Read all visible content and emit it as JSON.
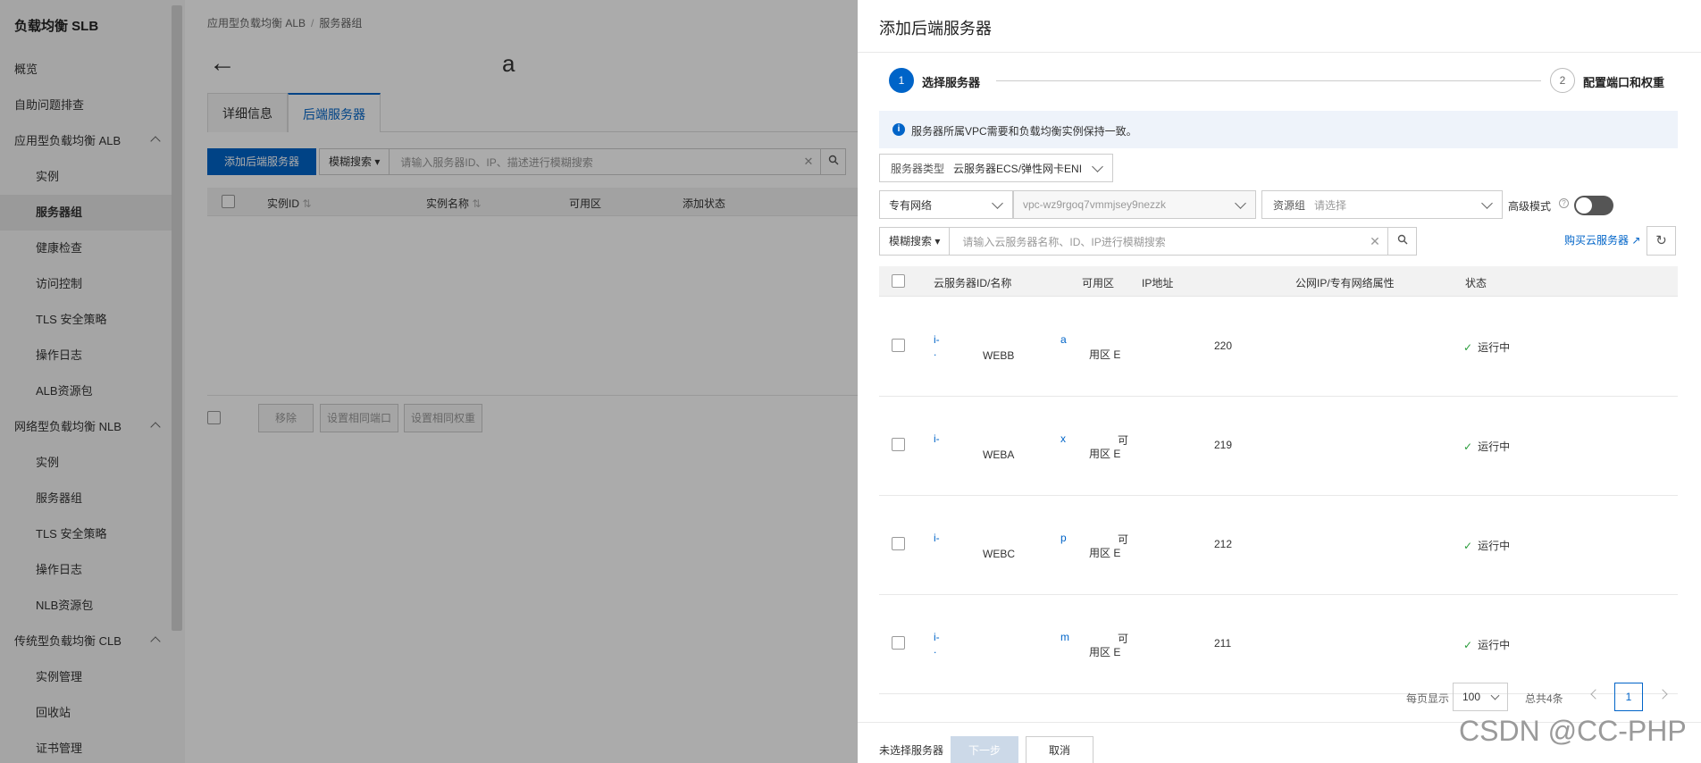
{
  "sidebar": {
    "brand": "负载均衡 SLB",
    "items": [
      {
        "label": "概览",
        "sub": false,
        "active": false,
        "chev": false
      },
      {
        "label": "自助问题排查",
        "sub": false,
        "active": false,
        "chev": false
      },
      {
        "label": "应用型负载均衡 ALB",
        "sub": false,
        "active": false,
        "chev": true
      },
      {
        "label": "实例",
        "sub": true,
        "active": false,
        "chev": false
      },
      {
        "label": "服务器组",
        "sub": true,
        "active": true,
        "chev": false
      },
      {
        "label": "健康检查",
        "sub": true,
        "active": false,
        "chev": false
      },
      {
        "label": "访问控制",
        "sub": true,
        "active": false,
        "chev": false
      },
      {
        "label": "TLS 安全策略",
        "sub": true,
        "active": false,
        "chev": false
      },
      {
        "label": "操作日志",
        "sub": true,
        "active": false,
        "chev": false
      },
      {
        "label": "ALB资源包",
        "sub": true,
        "active": false,
        "chev": false
      },
      {
        "label": "网络型负载均衡 NLB",
        "sub": false,
        "active": false,
        "chev": true
      },
      {
        "label": "实例",
        "sub": true,
        "active": false,
        "chev": false
      },
      {
        "label": "服务器组",
        "sub": true,
        "active": false,
        "chev": false
      },
      {
        "label": "TLS 安全策略",
        "sub": true,
        "active": false,
        "chev": false
      },
      {
        "label": "操作日志",
        "sub": true,
        "active": false,
        "chev": false
      },
      {
        "label": "NLB资源包",
        "sub": true,
        "active": false,
        "chev": false
      },
      {
        "label": "传统型负载均衡 CLB",
        "sub": false,
        "active": false,
        "chev": true
      },
      {
        "label": "实例管理",
        "sub": true,
        "active": false,
        "chev": false
      },
      {
        "label": "回收站",
        "sub": true,
        "active": false,
        "chev": false
      },
      {
        "label": "证书管理",
        "sub": true,
        "active": false,
        "chev": false
      }
    ]
  },
  "main": {
    "breadcrumb": [
      "应用型负载均衡 ALB",
      "服务器组"
    ],
    "back_icon": "←",
    "title_suffix": "a",
    "tabs": [
      "详细信息",
      "后端服务器"
    ],
    "add_button": "添加后端服务器",
    "search_mode": "模糊搜索",
    "search_placeholder": "请输入服务器ID、IP、描述进行模糊搜索",
    "table_headers": [
      "实例ID",
      "实例名称",
      "可用区",
      "添加状态"
    ],
    "footer_buttons": [
      "移除",
      "设置相同端口",
      "设置相同权重"
    ]
  },
  "drawer": {
    "title": "添加后端服务器",
    "steps": [
      {
        "num": "1",
        "label": "选择服务器"
      },
      {
        "num": "2",
        "label": "配置端口和权重"
      }
    ],
    "info": "服务器所属VPC需要和负载均衡实例保持一致。",
    "server_type_label": "服务器类型",
    "server_type_value": "云服务器ECS/弹性网卡ENI",
    "network": "专有网络",
    "vpc": "vpc-wz9rgoq7vmmjsey9nezzk",
    "resource_group_label": "资源组",
    "resource_group_placeholder": "请选择",
    "advanced_mode": "高级模式",
    "search_mode": "模糊搜索",
    "search_placeholder": "请输入云服务器名称、ID、IP进行模糊搜索",
    "buy_link": "购买云服务器",
    "table_headers": [
      "云服务器ID/名称",
      "可用区",
      "IP地址",
      "公网IP/专有网络属性",
      "状态"
    ],
    "rows": [
      {
        "id_prefix": "i-",
        "id_suffix": "a",
        "id_line2": ".",
        "name": "WEBB",
        "zone_top": "",
        "zone_bottom": "用区 E",
        "ip": "220",
        "status": "运行中"
      },
      {
        "id_prefix": "i-",
        "id_suffix": "x",
        "id_line2": "",
        "name": "WEBA",
        "zone_top": "可",
        "zone_bottom": "用区 E",
        "ip": "219",
        "status": "运行中"
      },
      {
        "id_prefix": "i-",
        "id_suffix": "p",
        "id_line2": "",
        "name": "WEBC",
        "zone_top": "可",
        "zone_bottom": "用区 E",
        "ip": "212",
        "status": "运行中"
      },
      {
        "id_prefix": "i-",
        "id_suffix": "m",
        "id_line2": ".",
        "name": "",
        "zone_top": "可",
        "zone_bottom": "用区 E",
        "ip": "211",
        "status": "运行中"
      }
    ],
    "pager": {
      "per_page_label": "每页显示",
      "per_page": "100",
      "total": "总共4条",
      "current_page": "1"
    },
    "footer_note": "未选择服务器",
    "next_button": "下一步",
    "cancel_button": "取消",
    "watermark": "CSDN @CC-PHP"
  }
}
